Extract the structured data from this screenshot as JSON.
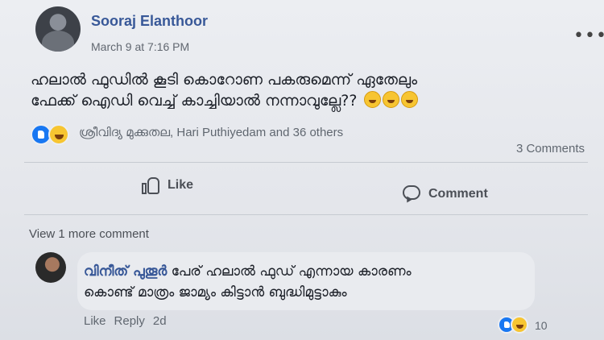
{
  "post": {
    "author": "Sooraj Elanthoor",
    "timestamp": "March 9 at 7:16 PM",
    "text_line1": "ഹലാൽ ഫുഡിൽ കൂടി കൊറോണ പകരുമെന്ന് ഏതേലും",
    "text_line2": "ഫേക്ക് ഐഡി വെച്ച് കാച്ചിയാൽ നന്നാവുല്ലേ??",
    "reactions_text": "ശ്രീവിദ്യ മുക്കുതല, Hari Puthiyedam and 36 others",
    "comments_count": "3 Comments",
    "like_label": "Like",
    "comment_label": "Comment"
  },
  "comments": {
    "view_more": "View 1 more comment",
    "items": [
      {
        "author": "വിനീത് പുതൂർ",
        "text_line1": "പേര് ഹലാൽ ഫുഡ് എന്നായ കാരണം",
        "text_line2": "കൊണ്ട് മാത്രം ജാമ്യം കിട്ടാൻ ബുദ്ധിമുട്ടാകും",
        "like_label": "Like",
        "reply_label": "Reply",
        "age": "2d",
        "reaction_count": "10"
      }
    ]
  },
  "icons": {
    "like_reaction": "like-reaction-icon",
    "haha_reaction": "haha-reaction-icon",
    "more": "more-options-icon"
  },
  "colors": {
    "author_blue": "#385898",
    "like_blue": "#1877f2",
    "emoji_yellow": "#f7c531"
  }
}
